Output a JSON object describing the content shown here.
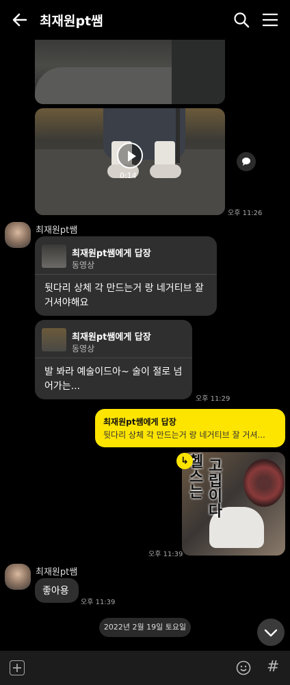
{
  "header": {
    "title": "최재원pt쌤"
  },
  "video": {
    "duration": "0:14",
    "time": "오후 11:26"
  },
  "sender_name": "최재원pt쌤",
  "messages": {
    "reply1": {
      "to": "최재원pt쌤에게 답장",
      "kind": "동영상",
      "text": "뒷다리 상체 각 만드는거 랑 네거티브 잘 거셔야해요"
    },
    "reply2": {
      "to": "최재원pt쌤에게 답장",
      "kind": "동영상",
      "text": "발 봐라 예술이드아~ 술이 절로 넘어가는...",
      "time": "오후 11:29"
    },
    "mine": {
      "to": "최재원pt쌤에게 답장",
      "quote": "뒷다리 상체 각 만드는거 랑 네거티브 잘 거셔...",
      "time": "오후 11:39"
    },
    "photo": {
      "caption_a": "헬스는",
      "caption_b": "고립이다"
    },
    "last": {
      "text": "좋아용",
      "time": "오후 11:39"
    }
  },
  "date_divider": "2022년 2월 19일 토요일",
  "icons": {
    "back": "arrow-left-icon",
    "search": "search-icon",
    "menu": "menu-icon",
    "play": "play-icon",
    "share": "chat-bubble-icon",
    "plus": "plus-icon",
    "emoji": "emoji-icon",
    "hash": "hash-icon",
    "down": "chevron-down-icon",
    "reply": "reply-arrow-icon"
  },
  "colors": {
    "my_bubble": "#fee500",
    "other_bubble": "#2f2f2f",
    "background": "#000000"
  }
}
